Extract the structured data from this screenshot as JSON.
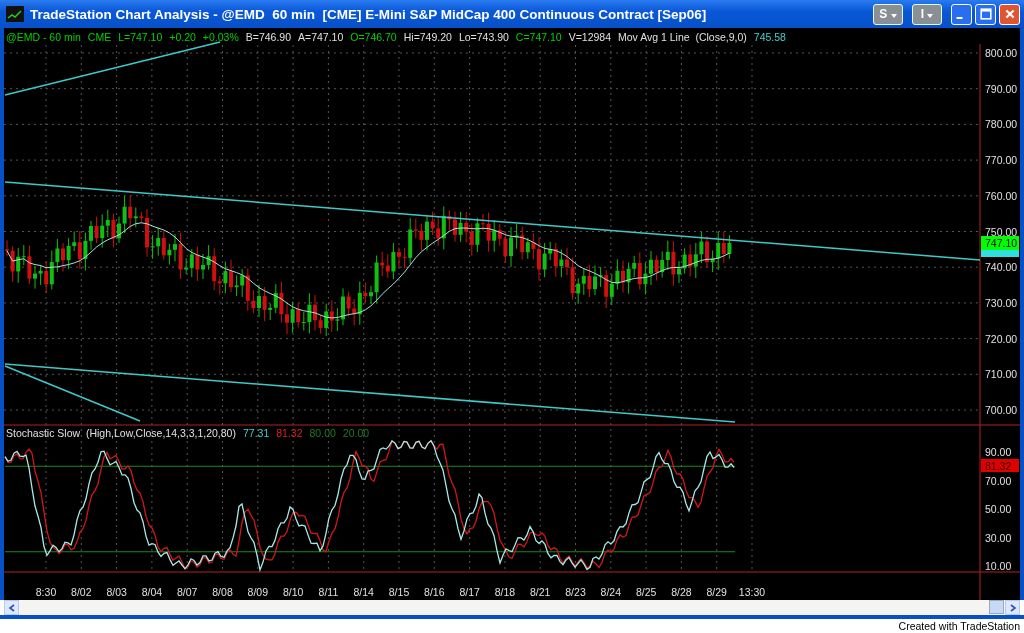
{
  "window": {
    "title": "TradeStation Chart Analysis - @EMD  60 min  [CME] E-Mini S&P MidCap 400 Continuous Contract [Sep06]",
    "menu_buttons": [
      "S",
      "I"
    ]
  },
  "price_panel": {
    "legend": [
      {
        "text": "@EMD - 60 min",
        "color": "#00d000"
      },
      {
        "text": "CME",
        "color": "#00d000"
      },
      {
        "text": "L=747.10",
        "color": "#00d000"
      },
      {
        "text": "+0.20",
        "color": "#00d000"
      },
      {
        "text": "+0.03%",
        "color": "#00d000"
      },
      {
        "text": "B=746.90",
        "color": "#e0e0e0"
      },
      {
        "text": "A=747.10",
        "color": "#e0e0e0"
      },
      {
        "text": "O=746.70",
        "color": "#00d000"
      },
      {
        "text": "Hi=749.20",
        "color": "#e0e0e0"
      },
      {
        "text": "Lo=743.90",
        "color": "#e0e0e0"
      },
      {
        "text": "C=747.10",
        "color": "#00d000"
      },
      {
        "text": "V=12984",
        "color": "#e0e0e0"
      },
      {
        "text": "Mov Avg 1 Line  (Close,9,0)",
        "color": "#e0e0e0"
      },
      {
        "text": "745.58",
        "color": "#40d0d0"
      }
    ],
    "y_axis": [
      "800.00",
      "790.00",
      "780.00",
      "770.00",
      "760.00",
      "750.00",
      "740.00",
      "730.00",
      "720.00",
      "710.00",
      "700.00"
    ],
    "last_price_tag": {
      "text": "747.10",
      "color": "#00ff00"
    }
  },
  "stochastic_panel": {
    "legend": [
      {
        "text": "Stochastic Slow  (High,Low,Close,14,3,3,1,20,80)",
        "color": "#e0e0e0"
      },
      {
        "text": "77.31",
        "color": "#40d0d0"
      },
      {
        "text": "81.32",
        "color": "#e02020"
      },
      {
        "text": "80.00",
        "color": "#207a20"
      },
      {
        "text": "20.00",
        "color": "#207a20"
      }
    ],
    "y_axis": [
      "90.00",
      "70.00",
      "50.00",
      "30.00",
      "10.00"
    ],
    "value_tag": {
      "text": "81.32",
      "color": "#e00000"
    }
  },
  "x_axis": [
    "8:30",
    "8/02",
    "8/03",
    "8/04",
    "8/07",
    "8/08",
    "8/09",
    "8/10",
    "8/11",
    "8/14",
    "8/15",
    "8/16",
    "8/17",
    "8/18",
    "8/21",
    "8/23",
    "8/24",
    "8/25",
    "8/28",
    "8/29",
    "13:30"
  ],
  "footer": "Created with TradeStation"
}
